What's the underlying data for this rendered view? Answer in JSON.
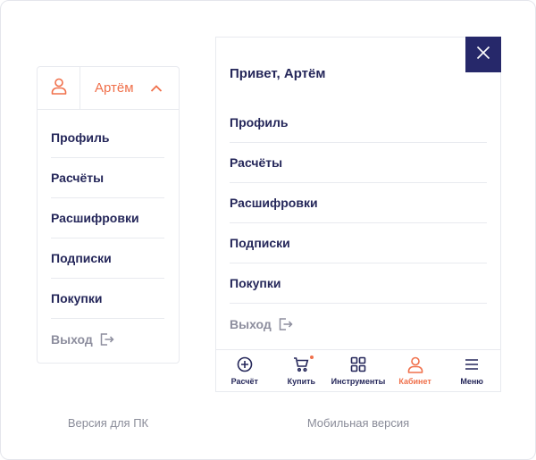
{
  "colors": {
    "accent": "#f0704b",
    "navy": "#26286a",
    "muted": "#8d8e9e",
    "divider": "#e8eaef"
  },
  "desktop": {
    "avatar_icon": "user-icon",
    "user_name": "Артём",
    "chevron_icon": "chevron-up-icon",
    "items": [
      {
        "label": "Профиль"
      },
      {
        "label": "Расчёты"
      },
      {
        "label": "Расшифровки"
      },
      {
        "label": "Подписки"
      },
      {
        "label": "Покупки"
      }
    ],
    "logout_label": "Выход",
    "logout_icon": "logout-icon",
    "caption": "Версия для ПК"
  },
  "mobile": {
    "close_icon": "close-icon",
    "greeting": "Привет, Артём",
    "items": [
      {
        "label": "Профиль"
      },
      {
        "label": "Расчёты"
      },
      {
        "label": "Расшифровки"
      },
      {
        "label": "Подписки"
      },
      {
        "label": "Покупки"
      }
    ],
    "logout_label": "Выход",
    "logout_icon": "logout-icon",
    "tabbar": [
      {
        "label": "Расчёт",
        "icon": "plus-circle-icon"
      },
      {
        "label": "Купить",
        "icon": "cart-icon"
      },
      {
        "label": "Инструменты",
        "icon": "grid-icon"
      },
      {
        "label": "Кабинет",
        "icon": "user-icon"
      },
      {
        "label": "Меню",
        "icon": "menu-icon"
      }
    ],
    "caption": "Мобильная версия"
  }
}
